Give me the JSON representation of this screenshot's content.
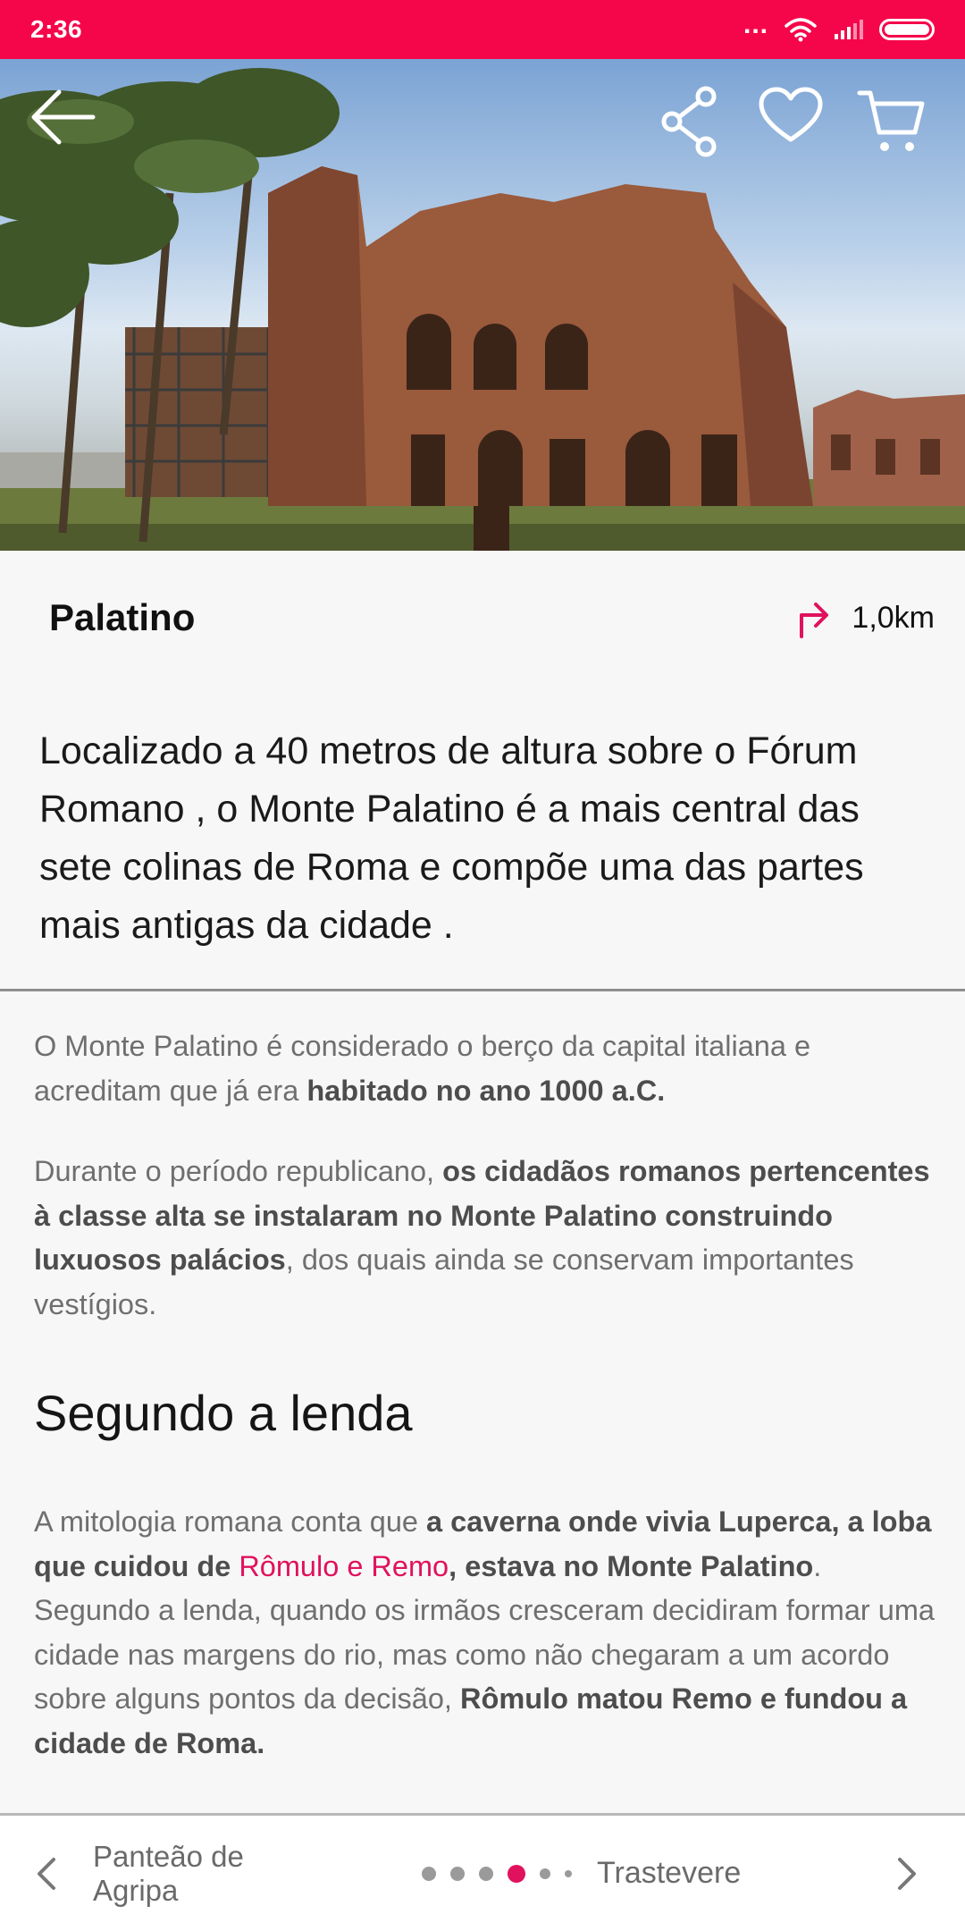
{
  "status_bar": {
    "time": "2:36",
    "dots": "...",
    "accent_color": "#f5064a"
  },
  "hero": {
    "back_icon": "arrow-left-icon",
    "share_icon": "share-icon",
    "favorite_icon": "heart-icon",
    "cart_icon": "cart-icon"
  },
  "place": {
    "title": "Palatino",
    "distance": "1,0km",
    "distance_icon": "turn-right-arrow-icon",
    "accent_color": "#e0125d"
  },
  "lead": "Localizado a 40 metros de altura sobre o Fórum Romano , o Monte Palatino é  a mais central das sete colinas de Roma  e compõe uma das partes mais antigas da cidade .",
  "paragraph_1": {
    "normal_1": "O Monte Palatino é considerado o berço da capital italiana e acreditam que já era ",
    "bold_1": "habitado no ano 1000 a.C."
  },
  "paragraph_2": {
    "normal_1": "Durante o período republicano, ",
    "bold_1": "os cidadãos romanos pertencentes à classe alta se instalaram no Monte Palatino construindo luxuosos palácios",
    "normal_2": ", dos quais ainda se conservam importantes vestígios."
  },
  "section_heading": "Segundo a lenda",
  "paragraph_3": {
    "normal_1": "A mitologia romana conta que ",
    "bold_1": "a caverna onde vivia Luperca, a loba que cuidou de ",
    "link_1": "Rômulo e Remo",
    "bold_2": ", estava no Monte Palatino",
    "normal_2": ". Segundo a lenda, quando os irmãos cresceram decidiram formar uma cidade nas margens do rio, mas como não chegaram a um acordo sobre alguns pontos da decisão, ",
    "bold_3": "Rômulo matou Remo e fundou a cidade de Roma."
  },
  "bottom_nav": {
    "prev_label": "Panteão de Agripa",
    "next_label": "Trastevere",
    "prev_icon": "chevron-left-icon",
    "next_icon": "chevron-right-icon",
    "page_count": 6,
    "active_page": 4
  }
}
